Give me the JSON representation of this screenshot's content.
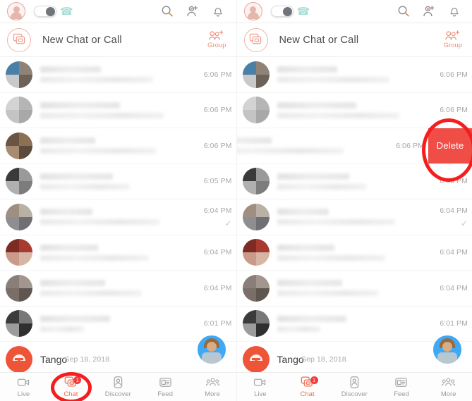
{
  "app": {
    "name": "Tango"
  },
  "topbar": {
    "avatar_name": "profile-avatar",
    "toggle_label": "call-toggle",
    "phone_icon": "phone-icon",
    "icons": [
      {
        "name": "search-icon",
        "label": "Search"
      },
      {
        "name": "add-contact-icon",
        "label": "Add Contact"
      },
      {
        "name": "bell-icon",
        "label": "Notifications"
      }
    ]
  },
  "new_chat": {
    "label": "New Chat or Call",
    "group_label": "Group",
    "compose_icon": "compose-chat-icon",
    "group_icon": "add-group-icon"
  },
  "chats": [
    {
      "time": "6:06 PM",
      "name_w": 42,
      "msg_w": 78,
      "checked": false,
      "av": [
        "#4a7fa8",
        "#8f8378",
        "#c9c9c9",
        "#6d6258"
      ]
    },
    {
      "time": "6:06 PM",
      "name_w": 55,
      "msg_w": 85,
      "checked": false,
      "av": [
        "#d3d3d3",
        "#b5b5b5",
        "#c4c4c4",
        "#a8a8a8"
      ]
    },
    {
      "time": "6:06 PM",
      "name_w": 38,
      "msg_w": 80,
      "checked": false,
      "av": [
        "#6b5444",
        "#8d6f55",
        "#a88c72",
        "#5c4a3c"
      ]
    },
    {
      "time": "6:05 PM",
      "name_w": 50,
      "msg_w": 62,
      "checked": false,
      "av": [
        "#3a3a3a",
        "#9a9a9a",
        "#b0b0b0",
        "#7c7c7c"
      ]
    },
    {
      "time": "6:04 PM",
      "name_w": 36,
      "msg_w": 82,
      "checked": true,
      "av": [
        "#9e8f80",
        "#b9b0a6",
        "#8e8e92",
        "#6f6f74"
      ]
    },
    {
      "time": "6:04 PM",
      "name_w": 40,
      "msg_w": 75,
      "checked": false,
      "av": [
        "#7e2b24",
        "#a83b2f",
        "#c99a8a",
        "#d8b4a4"
      ]
    },
    {
      "time": "6:04 PM",
      "name_w": 45,
      "msg_w": 70,
      "checked": false,
      "av": [
        "#8a7f78",
        "#a2968e",
        "#7a6f68",
        "#5f564f"
      ]
    },
    {
      "time": "6:01 PM",
      "name_w": 48,
      "msg_w": 30,
      "checked": false,
      "av": [
        "#3b3b3b",
        "#787878",
        "#9c9c9c",
        "#2f2f2f"
      ]
    }
  ],
  "tango_row": {
    "name": "Tango",
    "time": "Sep 18, 2018",
    "logo": "tango-logo"
  },
  "swipe": {
    "delete_label": "Delete",
    "swiped_row_index": 2,
    "delete_color": "#ef4d45"
  },
  "tabs": [
    {
      "name": "live",
      "label": "Live",
      "icon": "video-camera-icon",
      "active": false,
      "badge": ""
    },
    {
      "name": "chat",
      "label": "Chat",
      "icon": "chat-bubble-icon",
      "active": true,
      "badge": "1"
    },
    {
      "name": "discover",
      "label": "Discover",
      "icon": "person-card-icon",
      "active": false,
      "badge": ""
    },
    {
      "name": "feed",
      "label": "Feed",
      "icon": "feed-card-icon",
      "active": false,
      "badge": ""
    },
    {
      "name": "more",
      "label": "More",
      "icon": "people-group-icon",
      "active": false,
      "badge": ""
    }
  ],
  "annotations": {
    "color": "#f51d1d",
    "chat_tab_highlight": "red-ellipse-chat-tab",
    "delete_highlight": "red-ellipse-delete-button"
  },
  "colors": {
    "accent": "#ef6a4c",
    "delete": "#ef4d45",
    "annotation": "#f51d1d",
    "muted_text": "#a9a9a9",
    "primary_text": "#4c4c4c"
  }
}
